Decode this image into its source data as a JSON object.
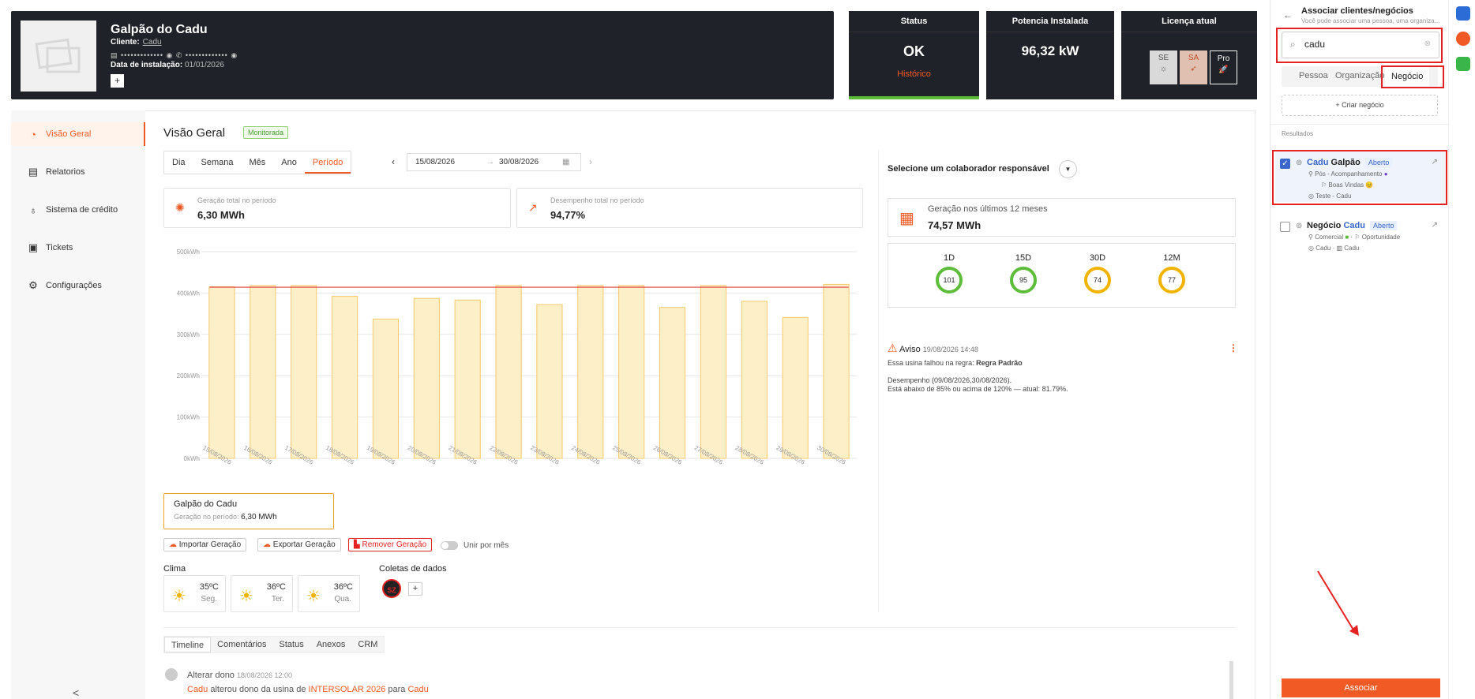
{
  "header": {
    "plant_name": "Galpão do Cadu",
    "client_label": "Cliente:",
    "client_name": "Cadu",
    "masked": "▤ ••••••••••••• ◉   ✆ ••••••••••••• ◉",
    "install_label": "Data de instalação:",
    "install_date": "01/01/2026",
    "add": "+"
  },
  "cards": {
    "status_title": "Status",
    "status_value": "OK",
    "status_link": "Histórico",
    "power_title": "Potencia Instalada",
    "power_value": "96,32 kW",
    "license_title": "Licença atual",
    "lic_se": "SE",
    "lic_sa": "SA",
    "lic_pro": "Pro"
  },
  "nav": {
    "items": [
      {
        "label": "Visão Geral",
        "icon": "gauge-icon"
      },
      {
        "label": "Relatorios",
        "icon": "report-icon"
      },
      {
        "label": "Sistema de crédito",
        "icon": "bulb-icon"
      },
      {
        "label": "Tickets",
        "icon": "ticket-icon"
      },
      {
        "label": "Configurações",
        "icon": "gear-icon"
      }
    ],
    "collapse": "<"
  },
  "main": {
    "title": "Visão Geral",
    "badge": "Monitorada",
    "tabs": [
      "Dia",
      "Semana",
      "Mês",
      "Ano",
      "Período"
    ],
    "date_from": "15/08/2026",
    "date_to": "30/08/2026",
    "kpi1_label": "Geração total no período",
    "kpi1_value": "6,30 MWh",
    "kpi2_label": "Desempenho total no período",
    "kpi2_value": "94,77%",
    "summary_name": "Galpão do Cadu",
    "summary_label": "Geração no período:",
    "summary_value": "6,30 MWh",
    "btn_import": "Importar Geração",
    "btn_export": "Exportar Geração",
    "btn_remove": "Remover Geração",
    "toggle_label": "Unir por mês",
    "clima_label": "Clima",
    "coletas_label": "Coletas de dados",
    "coletas_logo": "SZ",
    "coletas_add": "+",
    "weather": [
      {
        "temp": "35ºC",
        "day": "Seg."
      },
      {
        "temp": "36ºC",
        "day": "Ter."
      },
      {
        "temp": "36ºC",
        "day": "Qua."
      }
    ],
    "bottom_tabs": [
      "Timeline",
      "Comentários",
      "Status",
      "Anexos",
      "CRM"
    ],
    "timeline_title": "Alterar dono",
    "timeline_time": "18/08/2026 12:00",
    "timeline_u1": "Cadu",
    "timeline_t1": " alterou dono da usina de ",
    "timeline_u2": "INTERSOLAR 2026",
    "timeline_t2": " para ",
    "timeline_u3": "Cadu"
  },
  "right": {
    "select_label": "Selecione um colaborador responsável",
    "gen_label": "Geração nos últimos 12 meses",
    "gen_value": "74,57 MWh",
    "perf": [
      {
        "label": "1D",
        "value": "101",
        "color": "#5dbd3b"
      },
      {
        "label": "15D",
        "value": "95",
        "color": "#5dbd3b"
      },
      {
        "label": "30D",
        "value": "74",
        "color": "#f0b400"
      },
      {
        "label": "12M",
        "value": "77",
        "color": "#f0b400"
      }
    ],
    "aviso_title": "Aviso",
    "aviso_time": "19/08/2026 14:48",
    "aviso_rule_prefix": "Essa usina falhou na regra: ",
    "aviso_rule": "Regra Padrão",
    "aviso_l1": "Desempenho (09/08/2026,30/08/2026).",
    "aviso_l2": "Está abaixo de 85% ou acima de 120% — atual: 81.79%."
  },
  "side": {
    "title": "Associar clientes/negócios",
    "subtitle": "Você pode associar uma pessoa, uma organiza...",
    "search_value": "cadu",
    "tabs": [
      "Pessoa",
      "Organização",
      "Negócio"
    ],
    "create": "+ Criar negócio",
    "results_label": "Resultados",
    "items": [
      {
        "hl": "Cadu",
        "rest": " Galpão",
        "status": "Aberto",
        "l1": "Pós - Acompanhamento",
        "l2": "Boas Vindas",
        "l3": "Teste - Cadu",
        "checked": true
      },
      {
        "hl": "Cadu",
        "pre": "Negócio ",
        "rest": "",
        "status": "Aberto",
        "l1": "Comercial",
        "l1b": "Oportunidade",
        "l3": "Cadu",
        "l3b": "Cadu",
        "checked": false
      }
    ],
    "assoc": "Associar"
  },
  "chart_data": {
    "type": "bar",
    "categories": [
      "15/08/2026",
      "16/08/2026",
      "17/08/2026",
      "18/08/2026",
      "19/08/2026",
      "20/08/2026",
      "21/08/2026",
      "22/08/2026",
      "23/08/2026",
      "24/08/2026",
      "25/08/2026",
      "26/08/2026",
      "27/08/2026",
      "28/08/2026",
      "29/08/2026",
      "30/08/2026"
    ],
    "values": [
      415,
      418,
      418,
      392,
      337,
      387,
      383,
      418,
      372,
      418,
      418,
      365,
      418,
      380,
      341,
      421
    ],
    "reference_line": 414,
    "ylim": [
      0,
      500
    ],
    "yticks": [
      "0kWh",
      "100kWh",
      "200kWh",
      "300kWh",
      "400kWh",
      "500kWh"
    ],
    "bar_color": "#fdefc8",
    "bar_border": "#f5c96a",
    "line_color": "#e03a3a",
    "grid": true
  }
}
